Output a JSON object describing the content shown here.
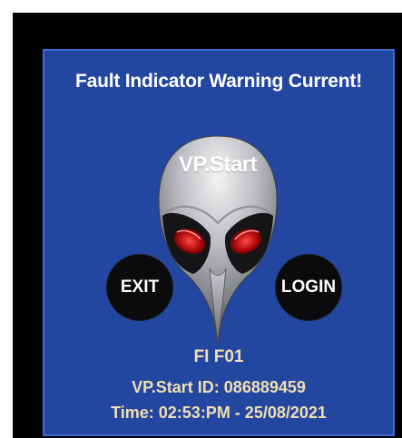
{
  "screen": {
    "title": "Fault Indicator Warning Current!",
    "logo_text": "VP.Start",
    "exit_label": "EXIT",
    "login_label": "LOGIN",
    "fault_code": "FI F01",
    "device_id": "VP.Start ID: 086889459",
    "timestamp": "Time: 02:53:PM - 25/08/2021"
  },
  "colors": {
    "panel_background": "#2347a0",
    "info_text": "#f2dfb0",
    "button_background": "#0b0b0d",
    "eye_glow": "#d01818"
  },
  "icons": {
    "logo": "skull-mask-icon"
  }
}
